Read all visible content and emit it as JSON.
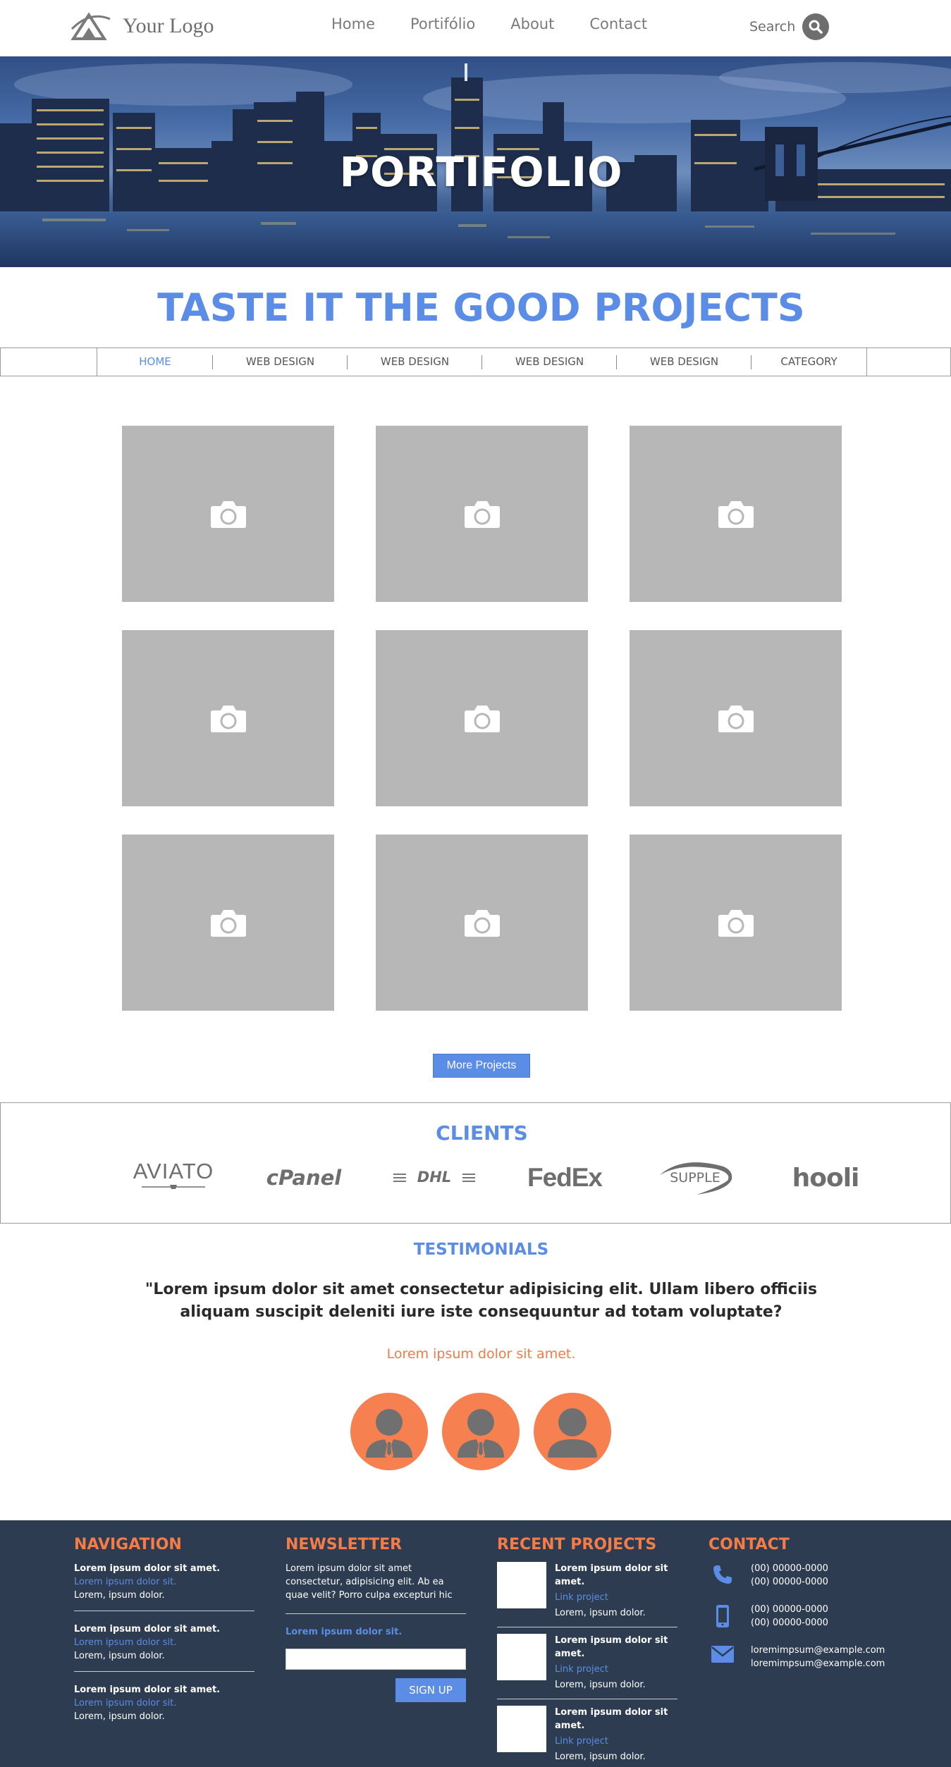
{
  "header": {
    "logo_text": "Your Logo",
    "nav": [
      "Home",
      "Portifólio",
      "About",
      "Contact"
    ],
    "search_label": "Search"
  },
  "hero": {
    "title": "PORTIFOLIO"
  },
  "main": {
    "heading": "TASTE IT THE GOOD PROJECTS",
    "categories": [
      "HOME",
      "WEB DESIGN",
      "WEB DESIGN",
      "WEB DESIGN",
      "WEB DESIGN",
      "CATEGORY"
    ],
    "more_button": "More Projects"
  },
  "clients": {
    "title": "CLIENTS",
    "logos": [
      "AVIATO",
      "cPanel",
      "DHL",
      "FedEx",
      "SUPPLE",
      "hooli"
    ]
  },
  "testimonials": {
    "title": "TESTIMONIALS",
    "quote": "\"Lorem ipsum dolor sit amet consectetur adipisicing elit. Ullam libero officiis aliquam suscipit deleniti iure iste consequuntur ad totam voluptate?",
    "author": "Lorem ipsum dolor sit amet."
  },
  "footer": {
    "navigation": {
      "title": "NAVIGATION",
      "items": [
        {
          "bold": "Lorem ipsum dolor sit amet.",
          "link": "Lorem ipsum dolor sit.",
          "text": "Lorem, ipsum dolor."
        },
        {
          "bold": "Lorem ipsum dolor sit amet.",
          "link": "Lorem ipsum dolor sit.",
          "text": "Lorem, ipsum dolor."
        },
        {
          "bold": "Lorem ipsum dolor sit amet.",
          "link": "Lorem ipsum dolor sit.",
          "text": "Lorem, ipsum dolor."
        }
      ]
    },
    "newsletter": {
      "title": "NEWSLETTER",
      "text": "Lorem ipsum dolor sit amet consectetur, adipisicing elit. Ab ea quae velit? Porro culpa excepturi hic",
      "link": "Lorem ipsum dolor sit.",
      "button": "SIGN UP"
    },
    "recent_projects": {
      "title": "RECENT PROJECTS",
      "items": [
        {
          "bold": "Lorem ipsum dolor sit amet.",
          "link": "Link project",
          "text": "Lorem, ipsum dolor."
        },
        {
          "bold": "Lorem ipsum dolor sit amet.",
          "link": "Link project",
          "text": "Lorem, ipsum dolor."
        },
        {
          "bold": "Lorem ipsum dolor sit amet.",
          "link": "Link project",
          "text": "Lorem, ipsum dolor."
        }
      ]
    },
    "contact": {
      "title": "CONTACT",
      "phone": [
        "(00) 00000-0000",
        "(00) 00000-0000"
      ],
      "mobile": [
        "(00) 00000-0000",
        "(00) 00000-0000"
      ],
      "email": [
        "loremimpsum@example.com",
        "loremimpsum@example.com"
      ]
    }
  },
  "colors": {
    "accent_blue": "#5c8de6",
    "accent_orange": "#f57c47",
    "tile_gray": "#b7b7b7",
    "footer_bg": "#2d3c51"
  },
  "icons": [
    "search-icon",
    "camera-icon",
    "person-icon",
    "phone-icon",
    "mobile-icon",
    "mail-icon"
  ]
}
